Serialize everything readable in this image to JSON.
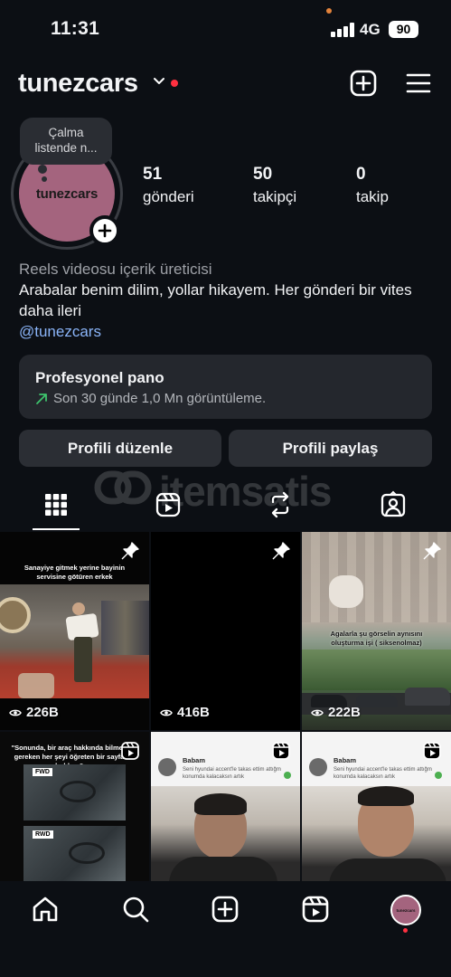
{
  "status_bar": {
    "time": "11:31",
    "network": "4G",
    "battery": "90"
  },
  "header": {
    "username": "tunezcars"
  },
  "profile": {
    "avatar_text": "tunezcars",
    "note": "Çalma listende n...",
    "stats": [
      {
        "count": "51",
        "label": "gönderi"
      },
      {
        "count": "50",
        "label": "takipçi"
      },
      {
        "count": "0",
        "label": "takip"
      }
    ],
    "category": "Reels videosu içerik üreticisi",
    "bio": "Arabalar benim dilim, yollar hikayem. Her gönderi bir vites daha ileri",
    "link": "@tunezcars"
  },
  "dashboard": {
    "title": "Profesyonel pano",
    "subtitle": "Son 30 günde 1,0 Mn görüntüleme."
  },
  "buttons": {
    "edit": "Profili düzenle",
    "share": "Profili paylaş"
  },
  "watermark": {
    "text": "itemsatis"
  },
  "grid": [
    {
      "caption": "Sanayiye gitmek yerine bayinin servisine götüren erkek",
      "views": "226B",
      "pinned": true
    },
    {
      "caption": "",
      "views": "416B",
      "pinned": true
    },
    {
      "caption": "Agalarla şu görselin aynısını oluşturma işi ( siksenolmaz)",
      "views": "222B",
      "pinned": true
    },
    {
      "caption": "\"Sonunda, bir araç hakkında bilmen gereken her şeyi öğreten bir sayfa buldun.\"",
      "labels": [
        "FWD",
        "RWD"
      ],
      "reel": true
    },
    {
      "chat_name": "Babam",
      "chat_msg": "Seni hyundai accent'le takas ettim attığm konumda kalacaksın artık",
      "reel": true
    },
    {
      "chat_name": "Babam",
      "chat_msg": "Seni hyundai accent'le takas ettim attığm konumda kalacaksın artık",
      "reel": true
    }
  ],
  "bottom_nav": {
    "avatar_text": "tunezcars"
  },
  "colors": {
    "background": "#0c0f14",
    "card": "#24272d",
    "button": "#2b2e34",
    "link": "#8ab4f8",
    "notification": "#ff3040",
    "avatar": "#a4647e"
  }
}
